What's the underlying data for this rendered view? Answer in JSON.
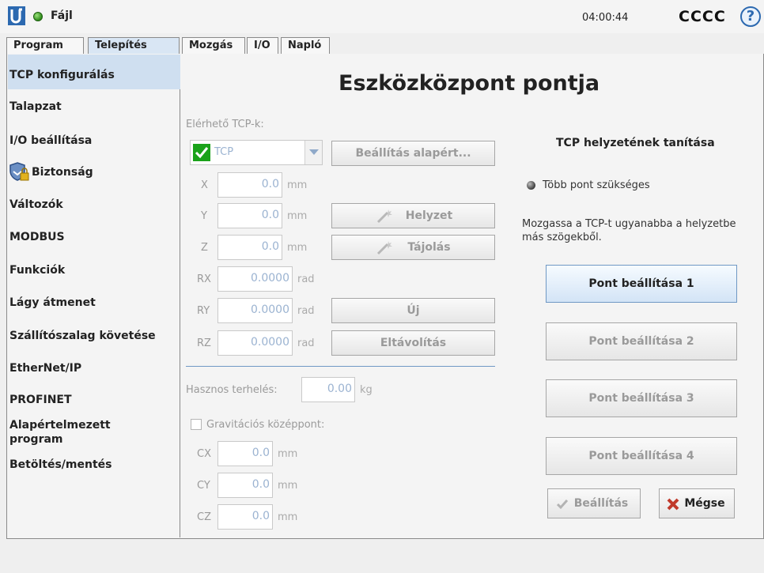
{
  "header": {
    "file_label": "Fájl",
    "clock": "04:00:44",
    "robot_name": "CCCC",
    "help": "?"
  },
  "tabs": [
    "Program",
    "Telepítés",
    "Mozgás",
    "I/O",
    "Napló"
  ],
  "sidebar": {
    "items": [
      "TCP konfigurálás",
      "Talapzat",
      "I/O beállítása",
      "Biztonság",
      "Változók",
      "MODBUS",
      "Funkciók",
      "Lágy átmenet",
      "Szállítószalag követése",
      "EtherNet/IP",
      "PROFINET",
      "Alapértelmezett program",
      "Betöltés/mentés"
    ]
  },
  "main": {
    "title": "Eszközközpont pontja",
    "available_label": "Elérhető TCP-k:",
    "tcp_selected": "TCP",
    "set_default_button": "Beállítás alapért...",
    "position_button": "Helyzet",
    "orientation_button": "Tájolás",
    "new_button": "Új",
    "remove_button": "Eltávolítás",
    "coords": [
      {
        "label": "X",
        "value": "0.0",
        "unit": "mm"
      },
      {
        "label": "Y",
        "value": "0.0",
        "unit": "mm"
      },
      {
        "label": "Z",
        "value": "0.0",
        "unit": "mm"
      },
      {
        "label": "RX",
        "value": "0.0000",
        "unit": "rad"
      },
      {
        "label": "RY",
        "value": "0.0000",
        "unit": "rad"
      },
      {
        "label": "RZ",
        "value": "0.0000",
        "unit": "rad"
      }
    ],
    "payload_label": "Hasznos terhelés:",
    "payload_value": "0.00",
    "payload_unit": "kg",
    "cog_label": "Gravitációs középpont:",
    "cog": [
      {
        "label": "CX",
        "value": "0.0",
        "unit": "mm"
      },
      {
        "label": "CY",
        "value": "0.0",
        "unit": "mm"
      },
      {
        "label": "CZ",
        "value": "0.0",
        "unit": "mm"
      }
    ]
  },
  "teach": {
    "title": "TCP helyzetének tanítása",
    "status": "Több pont szükséges",
    "instruction": "Mozgassa a TCP-t ugyanabba a helyzetbe más szögekből.",
    "points": [
      "Pont beállítása 1",
      "Pont beállítása 2",
      "Pont beállítása 3",
      "Pont beállítása 4"
    ],
    "set_button": "Beállítás",
    "cancel_button": "Mégse"
  },
  "colors": {
    "accent_blue": "#2c69b0",
    "active_tab": "#d9e6f4",
    "check_green": "#1aa21a",
    "cancel_red": "#c0392b"
  }
}
